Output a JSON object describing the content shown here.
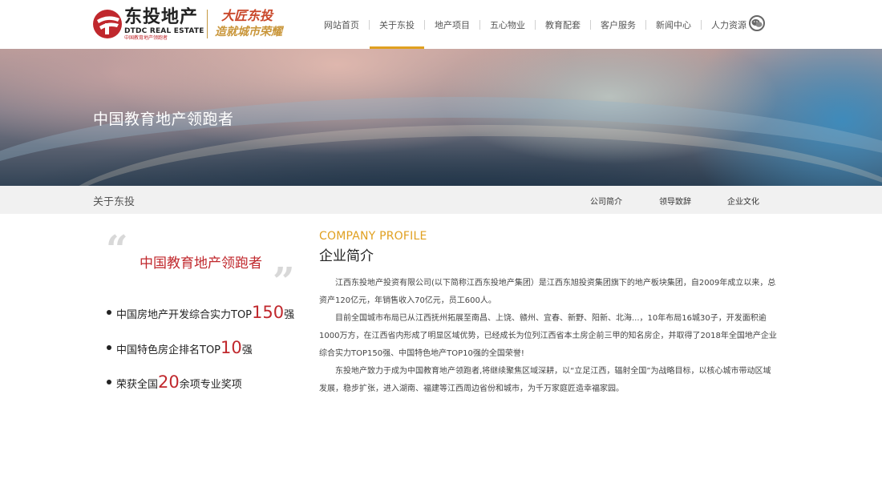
{
  "header": {
    "logo": {
      "name_cn": "东投地产",
      "name_en": "DTDC REAL ESTATE",
      "tagline_small": "中国教育地产领跑者"
    },
    "slogan": {
      "line1": "大匠东投",
      "line2": "造就城市荣耀"
    },
    "nav": [
      {
        "label": "网站首页",
        "active": false
      },
      {
        "label": "关于东投",
        "active": true
      },
      {
        "label": "地产项目",
        "active": false
      },
      {
        "label": "五心物业",
        "active": false
      },
      {
        "label": "教育配套",
        "active": false
      },
      {
        "label": "客户服务",
        "active": false
      },
      {
        "label": "新闻中心",
        "active": false
      },
      {
        "label": "人力资源",
        "active": false
      }
    ],
    "social_icon": "wechat-icon",
    "accent_color": "#e0a020"
  },
  "banner": {
    "title": "中国教育地产领跑者"
  },
  "subbar": {
    "section_title": "关于东投",
    "items": [
      {
        "label": "公司简介"
      },
      {
        "label": "领导致辞"
      },
      {
        "label": "企业文化"
      }
    ]
  },
  "highlights": {
    "title": "中国教育地产领跑者",
    "items": [
      {
        "prefix": "中国房地产开发综合实力TOP",
        "number": "150",
        "suffix": "强"
      },
      {
        "prefix": "中国特色房企排名TOP",
        "number": "10",
        "suffix": "强"
      },
      {
        "prefix": "荣获全国",
        "number": "20",
        "suffix": "余项专业奖项"
      }
    ],
    "brand_red": "#c0282d"
  },
  "profile": {
    "heading_en": "COMPANY PROFILE",
    "heading_cn": "企业简介",
    "paragraphs": [
      "江西东投地产投资有限公司(以下简称江西东投地产集团）是江西东旭投资集团旗下的地产板块集团，自2009年成立以来，总资产120亿元，年销售收入70亿元，员工600人。",
      "目前全国城市布局已从江西抚州拓展至南昌、上饶、赣州、宜春、新野、阳新、北海...，10年布局16城30子，开发面积逾1000万方，在江西省内形成了明显区域优势，已经成长为位列江西省本土房企前三甲的知名房企，并取得了2018年全国地产企业综合实力TOP150强、中国特色地产TOP10强的全国荣誉!",
      "东投地产致力于成为中国教育地产领跑者,将继续聚焦区域深耕，以“立足江西，辐射全国”为战略目标，以核心城市带动区域发展，稳步扩张，进入湖南、福建等江西周边省份和城市，为千万家庭匠造幸福家园。"
    ]
  }
}
